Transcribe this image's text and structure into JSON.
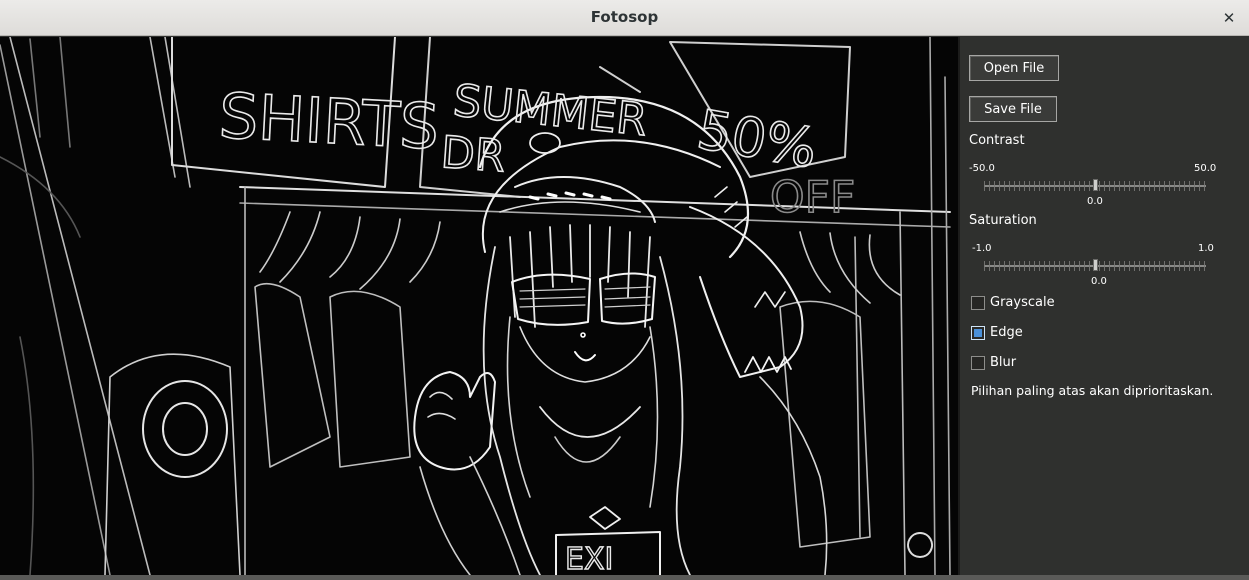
{
  "window": {
    "title": "Fotosop",
    "close_glyph": "✕"
  },
  "canvas": {
    "sign_shirts": "SHIRTS",
    "sign_summer_line1": "SUMMER",
    "sign_summer_line2": "DR",
    "sign_percent": "50%",
    "sign_off": "OFF",
    "shirt_logo": "EXI"
  },
  "panel": {
    "open_file_label": "Open File",
    "save_file_label": "Save File",
    "contrast": {
      "label": "Contrast",
      "min_label": "-50.0",
      "max_label": "50.0",
      "value_label": "0.0",
      "min": -50.0,
      "max": 50.0,
      "value": 0.0
    },
    "saturation": {
      "label": "Saturation",
      "min_label": "-1.0",
      "max_label": "1.0",
      "value_label": "0.0",
      "min": -1.0,
      "max": 1.0,
      "value": 0.0
    },
    "grayscale": {
      "label": "Grayscale",
      "checked": false
    },
    "edge": {
      "label": "Edge",
      "checked": true
    },
    "blur": {
      "label": "Blur",
      "checked": false
    },
    "note": "Pilihan paling atas akan diprioritaskan."
  },
  "colors": {
    "panel_bg": "#2f302e",
    "canvas_bg": "#050505",
    "accent": "#4a90d9"
  }
}
